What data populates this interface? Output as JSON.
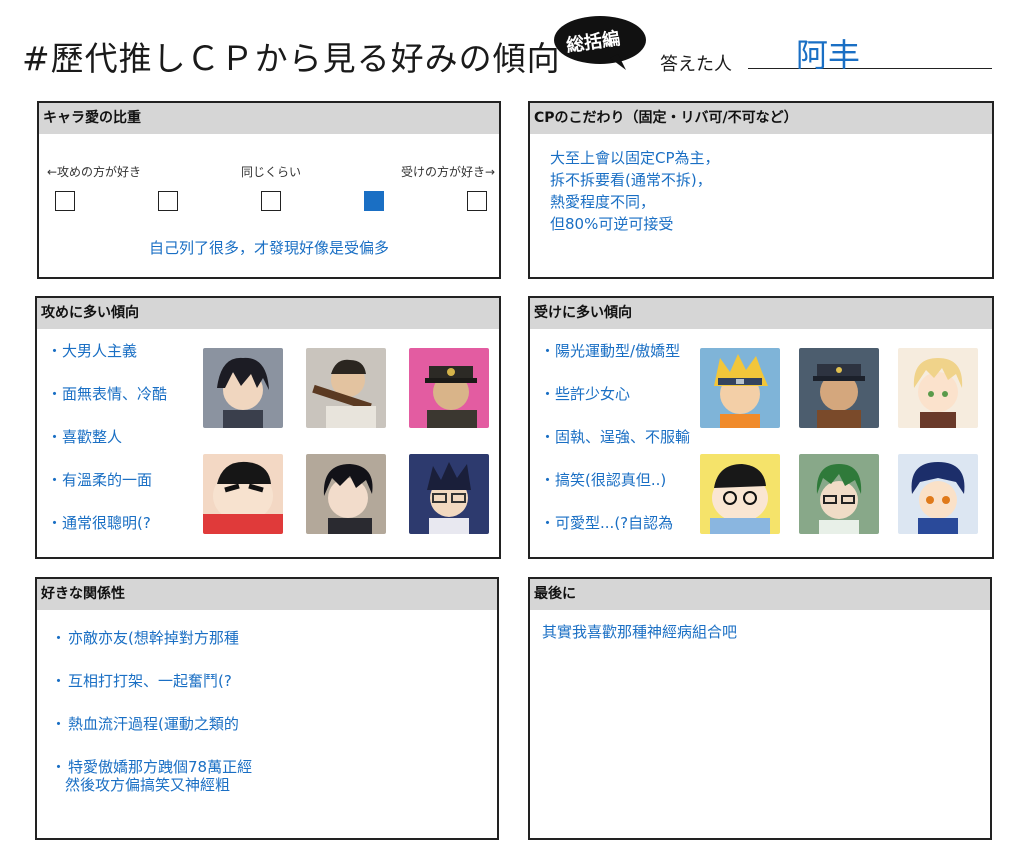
{
  "header": {
    "title": "#歷代推しＣＰから見る好みの傾向",
    "badge": "総括編",
    "answerer_label": "答えた人",
    "answerer_name": "阿丰"
  },
  "love_weight": {
    "title": "キャラ愛の比重",
    "left_label": "←攻めの方が好き",
    "mid_label": "同じくらい",
    "right_label": "受けの方が好き→",
    "scale_steps": 5,
    "selected_step": 4,
    "comment": "自己列了很多，才發現好像是受偏多"
  },
  "cp_pref": {
    "title": "CPのこだわり（固定・リバ可/不可など）",
    "lines": [
      "大至上會以固定CP為主，",
      "拆不拆要看(通常不拆)，",
      "熱愛程度不同，",
      "但80%可逆可接受"
    ]
  },
  "seme": {
    "title": "攻めに多い傾向",
    "items": [
      "大男人主義",
      "面無表情、冷酷",
      "喜歡整人",
      "有溫柔的一面",
      "通常很聰明(?"
    ],
    "portraits": [
      "dark-hair-ninja-portrait",
      "soldier-with-rifle-portrait",
      "capped-man-portrait",
      "crayon-boy-portrait",
      "black-hair-man-portrait",
      "glasses-boy-portrait"
    ]
  },
  "uke": {
    "title": "受けに多い傾向",
    "items": [
      "陽光運動型/傲嬌型",
      "些許少女心",
      "固執、逞強、不服輸",
      "搞笑(很認真但..)",
      "可愛型...(?自認為"
    ],
    "portraits": [
      "blond-ninja-portrait",
      "soldier-cap-portrait",
      "blond-boy-portrait",
      "crayon-friend-portrait",
      "green-hair-glasses-portrait",
      "masked-boy-portrait"
    ]
  },
  "relationship": {
    "title": "好きな関係性",
    "items": [
      "亦敵亦友(想幹掉對方那種",
      "互相打打架、一起奮鬥(?",
      "熱血流汗過程(運動之類的",
      "特愛傲嬌那方跩個78萬正經"
    ],
    "extra_line": "然後攻方偏搞笑又神經粗"
  },
  "last": {
    "title": "最後に",
    "text": "其實我喜歡那種神經病組合吧"
  },
  "colors": {
    "accent": "#1a6fc4",
    "header_bg": "#d6d6d6"
  }
}
